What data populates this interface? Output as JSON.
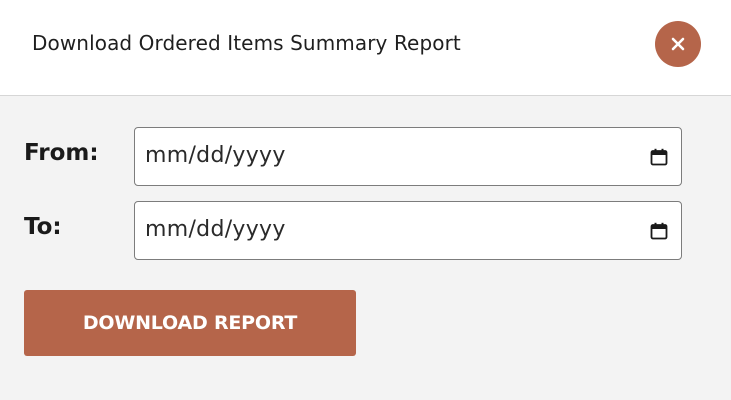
{
  "header": {
    "title": "Download Ordered Items Summary Report",
    "close_icon": "close-icon"
  },
  "form": {
    "from_label": "From:",
    "from_placeholder": "mm/dd/yyyy",
    "to_label": "To:",
    "to_placeholder": "mm/dd/yyyy",
    "calendar_icon": "calendar-icon"
  },
  "actions": {
    "download_label": "DOWNLOAD REPORT"
  },
  "colors": {
    "accent": "#b5654a",
    "header_bg": "#ffffff",
    "body_bg": "#f3f3f3"
  }
}
